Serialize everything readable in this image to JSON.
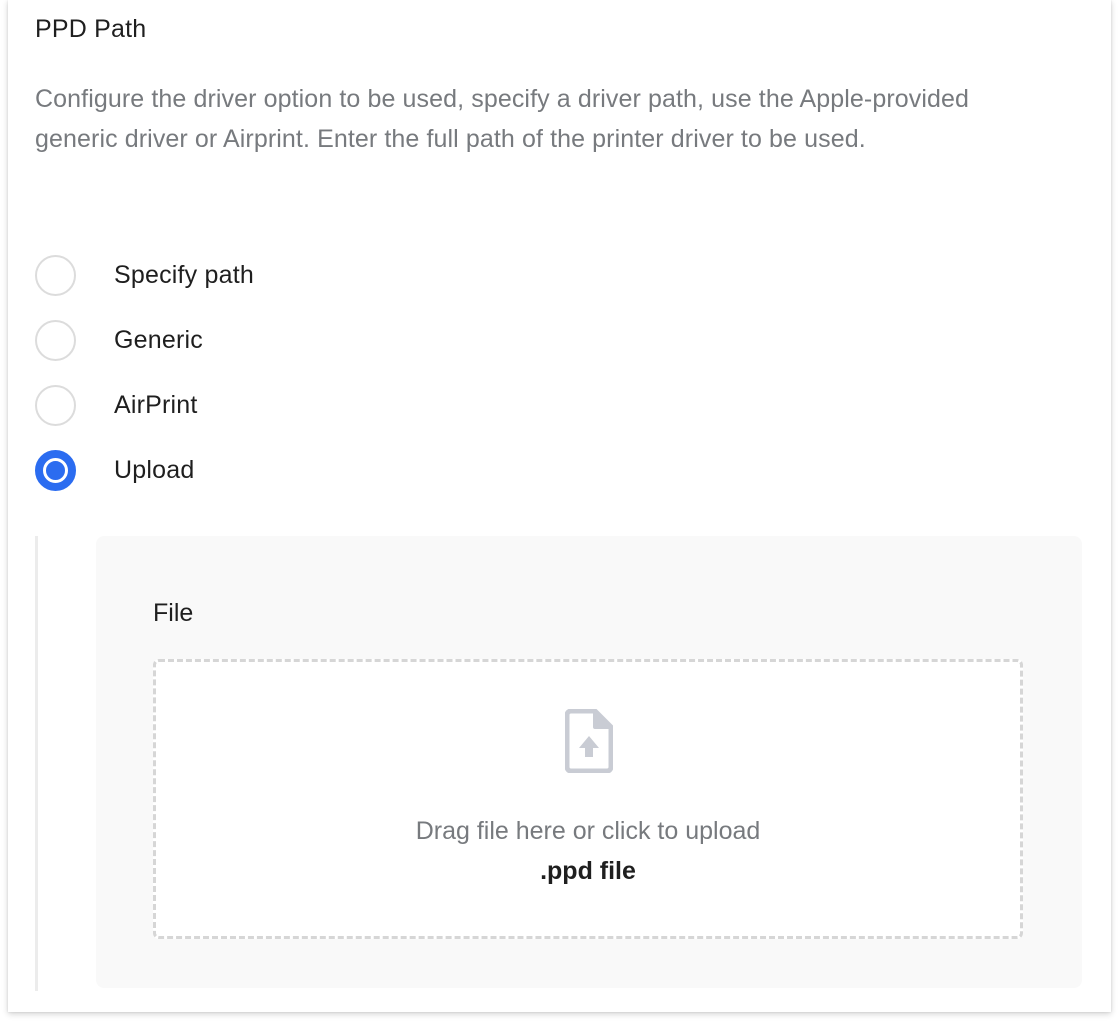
{
  "section": {
    "title": "PPD Path",
    "description": "Configure the driver option to be used, specify a driver path, use the Apple-provided generic driver or Airprint. Enter the full path of the printer driver to be used."
  },
  "radio_options": [
    {
      "label": "Specify path",
      "selected": false
    },
    {
      "label": "Generic",
      "selected": false
    },
    {
      "label": "AirPrint",
      "selected": false
    },
    {
      "label": "Upload",
      "selected": true
    }
  ],
  "upload": {
    "field_label": "File",
    "instruction": "Drag file here or click to upload",
    "accepted_type": ".ppd file",
    "icon": "file-upload-icon"
  },
  "colors": {
    "accent": "#2b6cf0",
    "text_primary": "#1f1f1f",
    "text_secondary": "#777a7e",
    "panel_bg": "#f9f9f9",
    "icon_gray": "#c9ccd4"
  }
}
